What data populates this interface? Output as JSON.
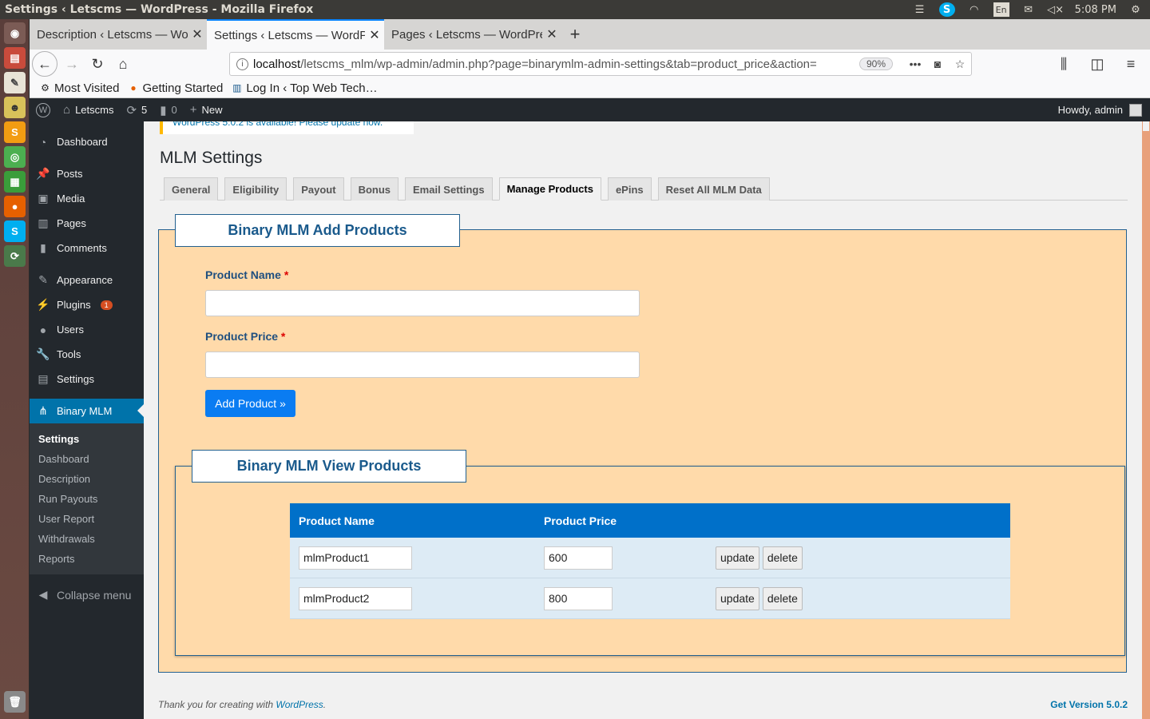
{
  "os": {
    "window_title": "Settings ‹ Letscms — WordPress - Mozilla Firefox",
    "keyboard": "En",
    "clock": "5:08 PM"
  },
  "browser": {
    "tabs": [
      {
        "label": "Description ‹ Letscms — WordPress"
      },
      {
        "label": "Settings ‹ Letscms — WordPress"
      },
      {
        "label": "Pages ‹ Letscms — WordPress"
      }
    ],
    "url_host": "localhost",
    "url_path": "/letscms_mlm/wp-admin/admin.php?page=binarymlm-admin-settings&tab=product_price&action=",
    "zoom": "90%",
    "bookmarks": [
      {
        "label": "Most Visited"
      },
      {
        "label": "Getting Started"
      },
      {
        "label": "Log In ‹ Top Web Tech…"
      }
    ]
  },
  "adminbar": {
    "site": "Letscms",
    "updates": "5",
    "comments": "0",
    "new": "New",
    "howdy": "Howdy, admin"
  },
  "menu": {
    "items": [
      {
        "label": "Dashboard"
      },
      {
        "label": "Posts"
      },
      {
        "label": "Media"
      },
      {
        "label": "Pages"
      },
      {
        "label": "Comments"
      },
      {
        "label": "Appearance"
      },
      {
        "label": "Plugins",
        "badge": "1"
      },
      {
        "label": "Users"
      },
      {
        "label": "Tools"
      },
      {
        "label": "Settings"
      },
      {
        "label": "Binary MLM"
      }
    ],
    "submenu": [
      {
        "label": "Settings"
      },
      {
        "label": "Dashboard"
      },
      {
        "label": "Description"
      },
      {
        "label": "Run Payouts"
      },
      {
        "label": "User Report"
      },
      {
        "label": "Withdrawals"
      },
      {
        "label": "Reports"
      }
    ],
    "collapse": "Collapse menu"
  },
  "main": {
    "notice": "WordPress 5.0.2 is available! Please update now.",
    "title": "MLM Settings",
    "tabs": [
      {
        "label": "General"
      },
      {
        "label": "Eligibility"
      },
      {
        "label": "Payout"
      },
      {
        "label": "Bonus"
      },
      {
        "label": "Email Settings"
      },
      {
        "label": "Manage Products"
      },
      {
        "label": "ePins"
      },
      {
        "label": "Reset All MLM Data"
      }
    ],
    "add_section": {
      "legend": "Binary MLM Add Products",
      "name_label": "Product Name",
      "price_label": "Product Price",
      "required_mark": "*",
      "button": "Add Product »"
    },
    "view_section": {
      "legend": "Binary MLM View Products",
      "columns": [
        "Product Name",
        "Product Price"
      ],
      "rows": [
        {
          "name": "mlmProduct1",
          "price": "600"
        },
        {
          "name": "mlmProduct2",
          "price": "800"
        }
      ],
      "update_label": "update",
      "delete_label": "delete"
    },
    "footer_text": "Thank you for creating with ",
    "footer_link": "WordPress",
    "footer_dot": ".",
    "version": "Get Version 5.0.2"
  },
  "colors": {
    "accent": "#0073aa",
    "panel_bg": "#ffdaaa",
    "table_header": "#0070c9"
  }
}
